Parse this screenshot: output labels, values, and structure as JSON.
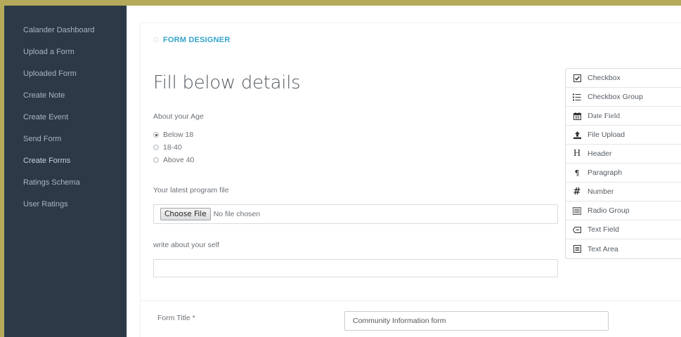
{
  "sidebar": {
    "items": [
      {
        "label": "Calander Dashboard"
      },
      {
        "label": "Upload a Form"
      },
      {
        "label": "Uploaded Form"
      },
      {
        "label": "Create Note"
      },
      {
        "label": "Create Event"
      },
      {
        "label": "Send Form"
      },
      {
        "label": "Create Forms"
      },
      {
        "label": "Ratings Schema"
      },
      {
        "label": "User Ratings"
      }
    ]
  },
  "breadcrumb": "FORM DESIGNER",
  "page_title": "Fill below details",
  "age": {
    "label": "About your Age",
    "options": [
      {
        "label": "Below 18",
        "checked": true
      },
      {
        "label": "18-40",
        "checked": false
      },
      {
        "label": "Above 40",
        "checked": false
      }
    ]
  },
  "program_file": {
    "label": "Your latest program file",
    "button": "Choose File",
    "status": "No file chosen"
  },
  "about_self": {
    "label": "write about your self",
    "value": ""
  },
  "form_title": {
    "label": "Form Title *",
    "value": "Community Information form"
  },
  "toolbox": {
    "items": [
      {
        "label": "Checkbox",
        "icon": "checkbox-icon"
      },
      {
        "label": "Checkbox Group",
        "icon": "checkbox-group-icon"
      },
      {
        "label": "Date Field",
        "icon": "calendar-icon"
      },
      {
        "label": "File Upload",
        "icon": "upload-icon"
      },
      {
        "label": "Header",
        "icon": "header-icon"
      },
      {
        "label": "Paragraph",
        "icon": "paragraph-icon"
      },
      {
        "label": "Number",
        "icon": "number-icon"
      },
      {
        "label": "Radio Group",
        "icon": "radio-group-icon"
      },
      {
        "label": "Text Field",
        "icon": "text-field-icon"
      },
      {
        "label": "Text Area",
        "icon": "text-area-icon"
      }
    ]
  },
  "colors": {
    "sidebar_bg": "#2c3a47",
    "accent": "#35a4c9",
    "outer_frame": "#b5a95a"
  }
}
